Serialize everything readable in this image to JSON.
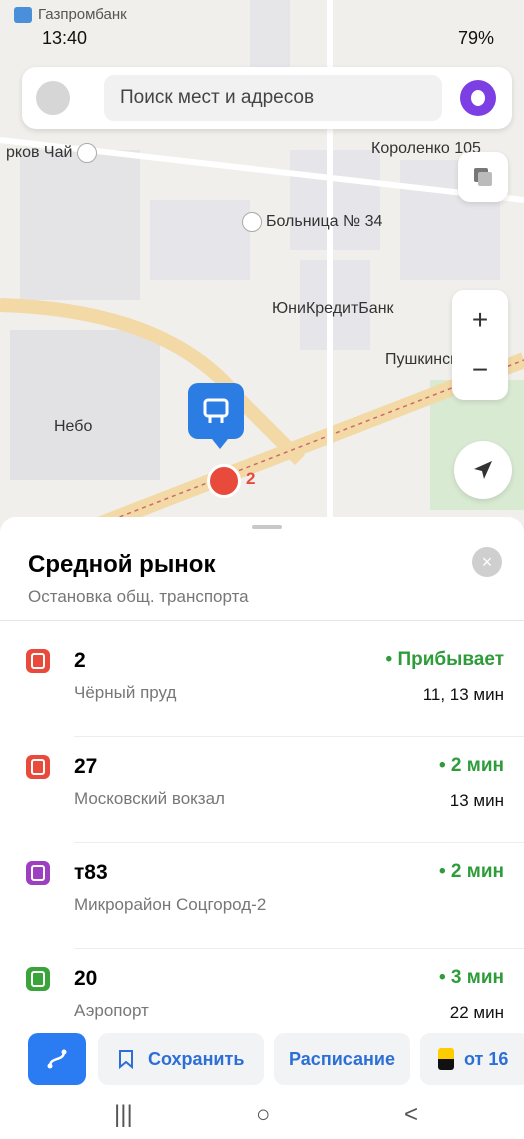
{
  "status_bar": {
    "notification_app": "Газпромбанк",
    "time": "13:40",
    "battery": "79%"
  },
  "search": {
    "placeholder": "Поиск мест и адресов"
  },
  "map": {
    "labels": {
      "tea": "рков Чай",
      "korolenko": "Короленко 105",
      "hospital": "Больница № 34",
      "bank": "ЮниКредитБанк",
      "pushkin": "Пушкинский",
      "nebo": "Небо",
      "tram_route": "2"
    },
    "controls": {
      "zoom_in": "+",
      "zoom_out": "−"
    }
  },
  "stop": {
    "name": "Средной рынок",
    "type": "Остановка общ. транспорта",
    "close": "×"
  },
  "routes": [
    {
      "number": "2",
      "destination": "Чёрный пруд",
      "status": "• Прибывает",
      "times": "11, 13 мин",
      "color": "#e84a3b"
    },
    {
      "number": "27",
      "destination": "Московский вокзал",
      "status": "• 2 мин",
      "times": "13 мин",
      "color": "#e84a3b"
    },
    {
      "number": "т83",
      "destination": "Микрорайон Соцгород-2",
      "status": "• 2 мин",
      "times": "",
      "color": "#9c3fc0"
    },
    {
      "number": "20",
      "destination": "Аэропорт",
      "status": "• 3 мин",
      "times": "22 мин",
      "color": "#3aa33a"
    }
  ],
  "actions": {
    "save": "Сохранить",
    "schedule": "Расписание",
    "taxi": "от 16"
  },
  "nav": {
    "recents": "|||",
    "home": "○",
    "back": "<"
  },
  "colors": {
    "accent": "#2b7bf2",
    "status_green": "#2e9c3a",
    "alice": "#7b3fe4"
  }
}
